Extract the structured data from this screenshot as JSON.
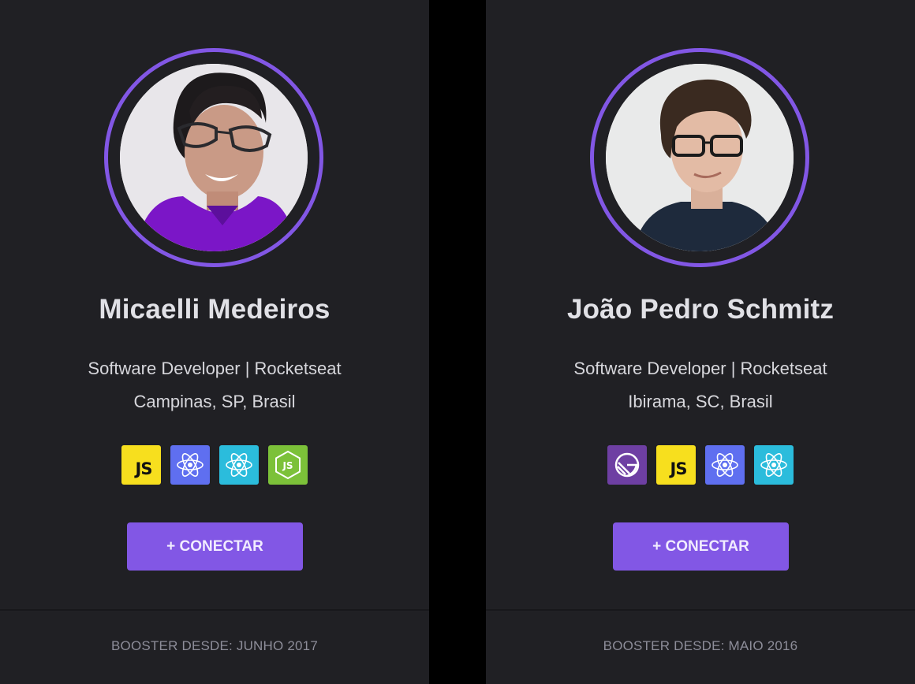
{
  "colors": {
    "background": "#000000",
    "card": "#202024",
    "accent": "#8257e5",
    "name_text": "#e1e1e6",
    "muted_text": "#8d8d99"
  },
  "cards": [
    {
      "name": "Micaelli Medeiros",
      "role": "Software Developer | Rocketseat",
      "location": "Campinas, SP, Brasil",
      "avatar_icon": "profile-photo",
      "techs": [
        {
          "icon": "javascript-icon",
          "label": "JS"
        },
        {
          "icon": "react-icon"
        },
        {
          "icon": "react-icon"
        },
        {
          "icon": "nodejs-icon"
        }
      ],
      "connect_label": "+ CONECTAR",
      "footer": "BOOSTER DESDE: JUNHO 2017"
    },
    {
      "name": "João Pedro Schmitz",
      "role": "Software Developer | Rocketseat",
      "location": "Ibirama, SC, Brasil",
      "avatar_icon": "profile-photo",
      "techs": [
        {
          "icon": "gatsby-icon"
        },
        {
          "icon": "javascript-icon",
          "label": "JS"
        },
        {
          "icon": "react-icon"
        },
        {
          "icon": "react-icon"
        }
      ],
      "connect_label": "+ CONECTAR",
      "footer": "BOOSTER DESDE: MAIO 2016"
    }
  ]
}
